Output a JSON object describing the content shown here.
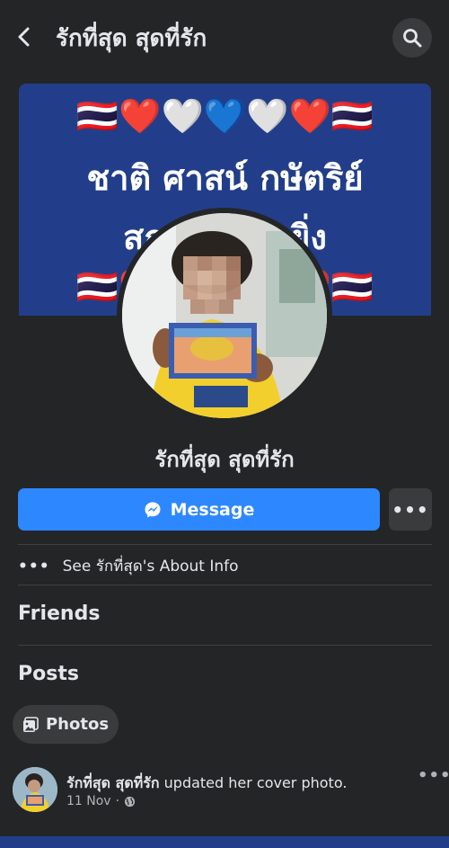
{
  "header": {
    "title": "รักที่สุด สุดที่รัก",
    "back_icon": "chevron-left-icon",
    "search_icon": "search-icon"
  },
  "cover": {
    "emoji_row": "🇹🇭❤️🤍💙🤍❤️🇹🇭",
    "line1": "ชาติ ศาสน์ กษัตริย์",
    "line2": "สถาบันที่รักยิ่ง",
    "bg_color": "#223e8a"
  },
  "profile": {
    "name": "รักที่สุด สุดที่รัก"
  },
  "actions": {
    "message_label": "Message",
    "messenger_icon": "messenger-icon",
    "more_label": "•••",
    "accent_color": "#2d88ff"
  },
  "about": {
    "dots": "•••",
    "label": "See รักที่สุด's About Info"
  },
  "sections": {
    "friends": "Friends",
    "posts": "Posts"
  },
  "photos_button": {
    "label": "Photos",
    "icon": "photos-icon"
  },
  "post": {
    "author": "รักที่สุด สุดที่รัก",
    "action": "updated her cover photo.",
    "date": "11 Nov",
    "separator": "·",
    "privacy_icon": "globe-icon",
    "more_label": "•••"
  }
}
